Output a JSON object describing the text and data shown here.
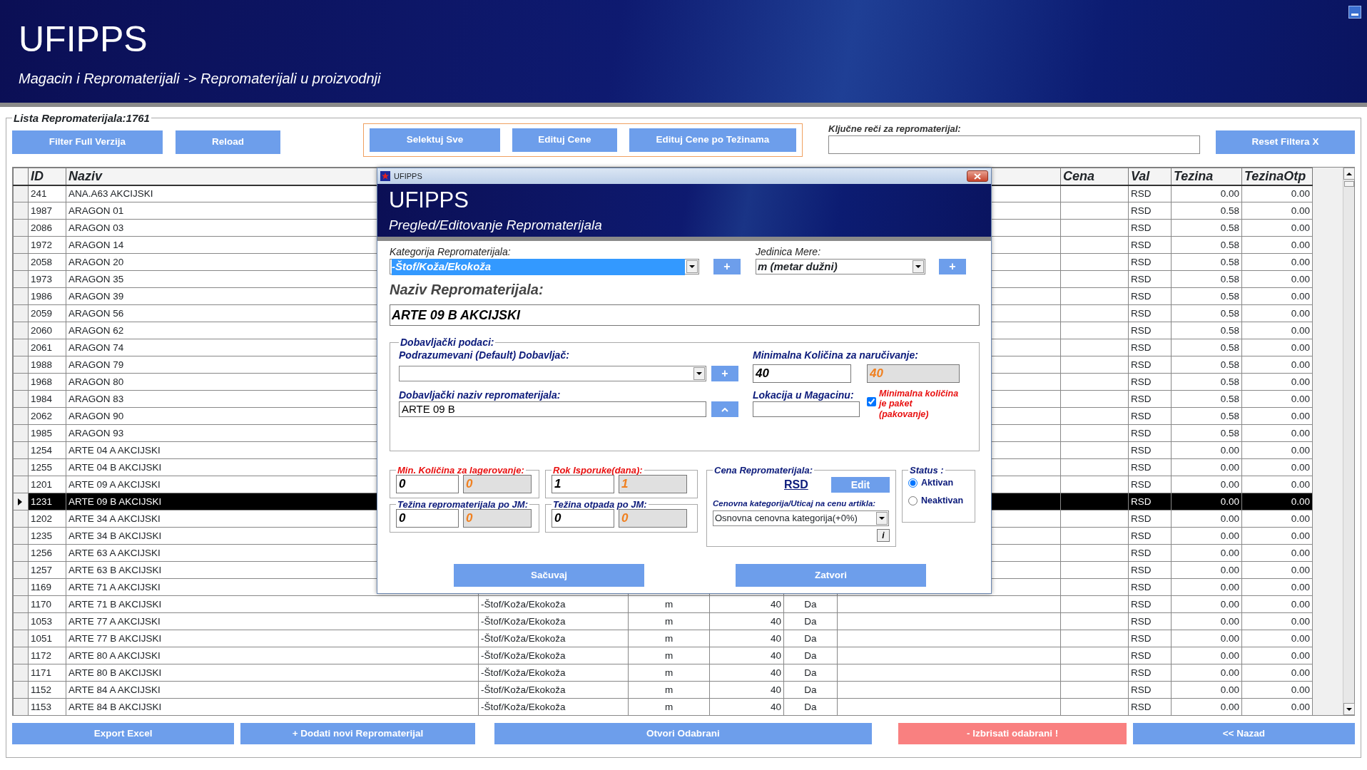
{
  "header": {
    "title": "UFIPPS",
    "breadcrumb": "Magacin i Repromaterijali -> Repromaterijali u proizvodnji"
  },
  "list_panel": {
    "legend": "Lista Repromaterijala:1761"
  },
  "toolbar": {
    "left_buttons": [
      "Filter Full Verzija",
      "Reload"
    ],
    "group_buttons": [
      "Selektuj Sve",
      "Edituj Cene",
      "Edituj Cene po Težinama"
    ],
    "search_label": "Ključne reči za repromaterijal:",
    "reset_button": "Reset Filtera X"
  },
  "table": {
    "headers": {
      "id": "ID",
      "name": "Naziv",
      "price": "Cena",
      "currency": "Val",
      "weight": "Tezina",
      "waste_weight": "TezinaOtp"
    },
    "rows": [
      {
        "id": "241",
        "name": "ANA.A63 AKCIJSKI",
        "currency": "RSD",
        "weight": "0.00",
        "waste_weight": "0.00",
        "selected": false
      },
      {
        "id": "1987",
        "name": "ARAGON 01",
        "currency": "RSD",
        "weight": "0.58",
        "waste_weight": "0.00",
        "selected": false
      },
      {
        "id": "2086",
        "name": "ARAGON 03",
        "currency": "RSD",
        "weight": "0.58",
        "waste_weight": "0.00",
        "selected": false
      },
      {
        "id": "1972",
        "name": "ARAGON 14",
        "currency": "RSD",
        "weight": "0.58",
        "waste_weight": "0.00",
        "selected": false
      },
      {
        "id": "2058",
        "name": "ARAGON 20",
        "currency": "RSD",
        "weight": "0.58",
        "waste_weight": "0.00",
        "selected": false
      },
      {
        "id": "1973",
        "name": "ARAGON 35",
        "currency": "RSD",
        "weight": "0.58",
        "waste_weight": "0.00",
        "selected": false
      },
      {
        "id": "1986",
        "name": "ARAGON 39",
        "currency": "RSD",
        "weight": "0.58",
        "waste_weight": "0.00",
        "selected": false
      },
      {
        "id": "2059",
        "name": "ARAGON 56",
        "currency": "RSD",
        "weight": "0.58",
        "waste_weight": "0.00",
        "selected": false
      },
      {
        "id": "2060",
        "name": "ARAGON 62",
        "currency": "RSD",
        "weight": "0.58",
        "waste_weight": "0.00",
        "selected": false
      },
      {
        "id": "2061",
        "name": "ARAGON 74",
        "currency": "RSD",
        "weight": "0.58",
        "waste_weight": "0.00",
        "selected": false
      },
      {
        "id": "1988",
        "name": "ARAGON 79",
        "currency": "RSD",
        "weight": "0.58",
        "waste_weight": "0.00",
        "selected": false
      },
      {
        "id": "1968",
        "name": "ARAGON 80",
        "currency": "RSD",
        "weight": "0.58",
        "waste_weight": "0.00",
        "selected": false
      },
      {
        "id": "1984",
        "name": "ARAGON 83",
        "currency": "RSD",
        "weight": "0.58",
        "waste_weight": "0.00",
        "selected": false
      },
      {
        "id": "2062",
        "name": "ARAGON 90",
        "currency": "RSD",
        "weight": "0.58",
        "waste_weight": "0.00",
        "selected": false
      },
      {
        "id": "1985",
        "name": "ARAGON 93",
        "currency": "RSD",
        "weight": "0.58",
        "waste_weight": "0.00",
        "selected": false
      },
      {
        "id": "1254",
        "name": "ARTE 04 A AKCIJSKI",
        "currency": "RSD",
        "weight": "0.00",
        "waste_weight": "0.00",
        "selected": false
      },
      {
        "id": "1255",
        "name": "ARTE 04 B AKCIJSKI",
        "currency": "RSD",
        "weight": "0.00",
        "waste_weight": "0.00",
        "selected": false
      },
      {
        "id": "1201",
        "name": "ARTE 09 A AKCIJSKI",
        "currency": "RSD",
        "weight": "0.00",
        "waste_weight": "0.00",
        "selected": false
      },
      {
        "id": "1231",
        "name": "ARTE 09 B AKCIJSKI",
        "currency": "RSD",
        "weight": "0.00",
        "waste_weight": "0.00",
        "selected": true
      },
      {
        "id": "1202",
        "name": "ARTE 34 A AKCIJSKI",
        "currency": "RSD",
        "weight": "0.00",
        "waste_weight": "0.00",
        "selected": false
      },
      {
        "id": "1235",
        "name": "ARTE 34 B AKCIJSKI",
        "currency": "RSD",
        "weight": "0.00",
        "waste_weight": "0.00",
        "selected": false
      },
      {
        "id": "1256",
        "name": "ARTE 63 A AKCIJSKI",
        "currency": "RSD",
        "weight": "0.00",
        "waste_weight": "0.00",
        "selected": false
      },
      {
        "id": "1257",
        "name": "ARTE 63 B AKCIJSKI",
        "currency": "RSD",
        "weight": "0.00",
        "waste_weight": "0.00",
        "selected": false
      },
      {
        "id": "1169",
        "name": "ARTE 71 A AKCIJSKI",
        "currency": "RSD",
        "weight": "0.00",
        "waste_weight": "0.00",
        "selected": false
      },
      {
        "id": "1170",
        "name": "ARTE 71 B AKCIJSKI",
        "column_3": "-Štof/Koža/Ekokoža",
        "column_4": "m",
        "column_5": "40",
        "column_6": "Da",
        "currency": "RSD",
        "weight": "0.00",
        "waste_weight": "0.00",
        "selected": false
      },
      {
        "id": "1053",
        "name": "ARTE 77 A AKCIJSKI",
        "column_3": "-Štof/Koža/Ekokoža",
        "column_4": "m",
        "column_5": "40",
        "column_6": "Da",
        "currency": "RSD",
        "weight": "0.00",
        "waste_weight": "0.00",
        "selected": false
      },
      {
        "id": "1051",
        "name": "ARTE 77 B AKCIJSKI",
        "column_3": "-Štof/Koža/Ekokoža",
        "column_4": "m",
        "column_5": "40",
        "column_6": "Da",
        "currency": "RSD",
        "weight": "0.00",
        "waste_weight": "0.00",
        "selected": false
      },
      {
        "id": "1172",
        "name": "ARTE 80 A AKCIJSKI",
        "column_3": "-Štof/Koža/Ekokoža",
        "column_4": "m",
        "column_5": "40",
        "column_6": "Da",
        "currency": "RSD",
        "weight": "0.00",
        "waste_weight": "0.00",
        "selected": false
      },
      {
        "id": "1171",
        "name": "ARTE 80 B AKCIJSKI",
        "column_3": "-Štof/Koža/Ekokoža",
        "column_4": "m",
        "column_5": "40",
        "column_6": "Da",
        "currency": "RSD",
        "weight": "0.00",
        "waste_weight": "0.00",
        "selected": false
      },
      {
        "id": "1152",
        "name": "ARTE 84 A AKCIJSKI",
        "column_3": "-Štof/Koža/Ekokoža",
        "column_4": "m",
        "column_5": "40",
        "column_6": "Da",
        "currency": "RSD",
        "weight": "0.00",
        "waste_weight": "0.00",
        "selected": false
      },
      {
        "id": "1153",
        "name": "ARTE 84 B AKCIJSKI",
        "column_3": "-Štof/Koža/Ekokoža",
        "column_4": "m",
        "column_5": "40",
        "column_6": "Da",
        "currency": "RSD",
        "weight": "0.00",
        "waste_weight": "0.00",
        "selected": false
      }
    ]
  },
  "bottom_buttons": [
    {
      "label": "Export Excel",
      "kind": "normal"
    },
    {
      "label": "+ Dodati novi Repromaterijal",
      "kind": "normal"
    },
    {
      "label": "Otvori Odabrani",
      "kind": "normal"
    },
    {
      "label": "- Izbrisati odabrani !",
      "kind": "danger"
    },
    {
      "label": "<< Nazad",
      "kind": "normal"
    }
  ],
  "dialog": {
    "window_title": "UFIPPS",
    "title": "UFIPPS",
    "subtitle": "Pregled/Editovanje Repromaterijala",
    "category": {
      "label": "Kategorija Repromaterijala:",
      "value": "-Štof/Koža/Ekokoža",
      "add": "+"
    },
    "unit": {
      "label": "Jedinica Mere:",
      "value": "m (metar dužni)",
      "add": "+"
    },
    "name": {
      "label": "Naziv Repromaterijala:",
      "value": "ARTE 09 B AKCIJSKI"
    },
    "supplier_group": {
      "legend": "Dobavljački podaci:",
      "default_supplier": {
        "label": "Podrazumevani (Default) Dobavljač:",
        "add": "+"
      },
      "min_order": {
        "label": "Minimalna Količina za naručivanje:",
        "value": "40",
        "computed": "40"
      },
      "supplier_name": {
        "label": "Dobavljački naziv repromaterijala:",
        "value": "ARTE 09 B"
      },
      "location": {
        "label": "Lokacija u Magacinu:"
      },
      "package": {
        "label": "Minimalna količina je paket (pakovanje)",
        "checked": true
      }
    },
    "min_stock": {
      "legend": "Min. Količina za lagerovanje:",
      "value": "0",
      "computed": "0"
    },
    "delivery": {
      "legend": "Rok Isporuke(dana):",
      "value": "1",
      "computed": "1"
    },
    "weight": {
      "legend": "Težina repromaterijala po JM:",
      "value": "0",
      "computed": "0"
    },
    "waste": {
      "legend": "Težina otpada po JM:",
      "value": "0",
      "computed": "0"
    },
    "price": {
      "legend": "Cena Repromaterijala:",
      "currency": "RSD",
      "edit": "Edit",
      "category_label": "Cenovna kategorija/Uticaj na cenu artikla:",
      "category_value": "Osnovna cenovna kategorija(+0%)",
      "info": "i"
    },
    "status": {
      "legend": "Status :",
      "options": [
        {
          "label": "Aktivan",
          "selected": true
        },
        {
          "label": "Neaktivan",
          "selected": false
        }
      ]
    },
    "buttons": [
      "Sačuvaj",
      "Zatvori"
    ]
  }
}
